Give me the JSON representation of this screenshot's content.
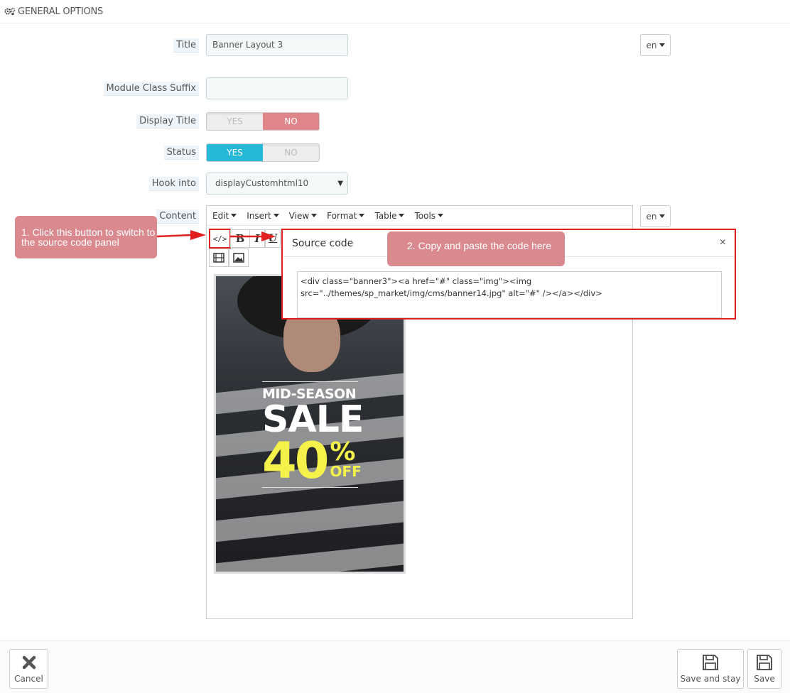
{
  "panel": {
    "heading": "GENERAL OPTIONS",
    "icon": "gears-icon"
  },
  "form": {
    "title": {
      "label": "Title",
      "value": "Banner Layout 3",
      "lang": "en"
    },
    "module_class_suffix": {
      "label": "Module Class Suffix",
      "value": ""
    },
    "display_title": {
      "label": "Display Title",
      "yes": "YES",
      "no": "NO",
      "selected": "NO"
    },
    "status": {
      "label": "Status",
      "yes": "YES",
      "no": "NO",
      "selected": "YES"
    },
    "hook_into": {
      "label": "Hook into",
      "value": "displayCustomhtml10"
    },
    "content": {
      "label": "Content",
      "lang": "en"
    }
  },
  "editor": {
    "menu": [
      "Edit",
      "Insert",
      "View",
      "Format",
      "Table",
      "Tools"
    ],
    "toolbar": {
      "source_code": "source-code-icon",
      "bold": "B",
      "italic": "I",
      "underline": "U",
      "media": "film-icon",
      "image": "image-icon"
    },
    "banner": {
      "line1": "MID-SEASON",
      "line2": "SALE",
      "number": "40",
      "percent": "%",
      "off": "OFF"
    }
  },
  "source_code_dialog": {
    "title": "Source code",
    "close": "×",
    "code": "<div class=\"banner3\"><a href=\"#\" class=\"img\"><img src=\"../themes/sp_market/img/cms/banner14.jpg\" alt=\"#\" /></a></div>"
  },
  "annotations": {
    "step1": "1. Click this button to switch to the source code panel",
    "step2": "2. Copy and paste the code here",
    "color": "#da8a8f",
    "highlight_color": "#e02020"
  },
  "footer": {
    "cancel": "Cancel",
    "save_and_stay": "Save and stay",
    "save": "Save"
  },
  "colors": {
    "blue": "#25b9d7",
    "red": "#e0858a"
  }
}
